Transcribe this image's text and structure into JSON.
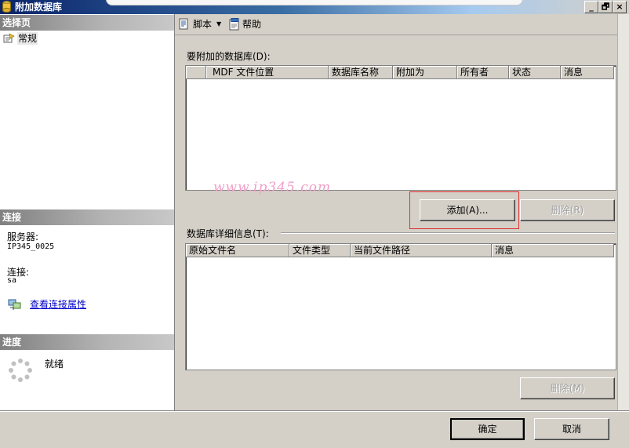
{
  "window": {
    "title": "附加数据库",
    "controls": [
      "_",
      "🗗",
      "×"
    ]
  },
  "left": {
    "select_page_header": "选择页",
    "pages": [
      {
        "label": "常规"
      }
    ],
    "connection_header": "连接",
    "server_label": "服务器:",
    "server_value": "IP345_0025",
    "connection_label": "连接:",
    "connection_value": "sa",
    "view_props_link": "查看连接属性",
    "progress_header": "进度",
    "progress_status": "就绪"
  },
  "toolbar": {
    "script_label": "脚本",
    "help_label": "帮助"
  },
  "attach": {
    "section_label": "要附加的数据库(D):",
    "columns": [
      "",
      "MDF 文件位置",
      "数据库名称",
      "附加为",
      "所有者",
      "状态",
      "消息"
    ],
    "add_button": "添加(A)...",
    "remove_button": "删除(R)"
  },
  "watermark": "www.ip345.com",
  "details": {
    "section_label": "数据库详细信息(T):",
    "columns": [
      "原始文件名",
      "文件类型",
      "当前文件路径",
      "消息"
    ],
    "remove_button": "删除(M)"
  },
  "footer": {
    "ok_button": "确定",
    "cancel_button": "取消"
  },
  "colors": {
    "highlight_box": "#e03030",
    "watermark": "#f0a0c8",
    "link": "#0000cc"
  }
}
